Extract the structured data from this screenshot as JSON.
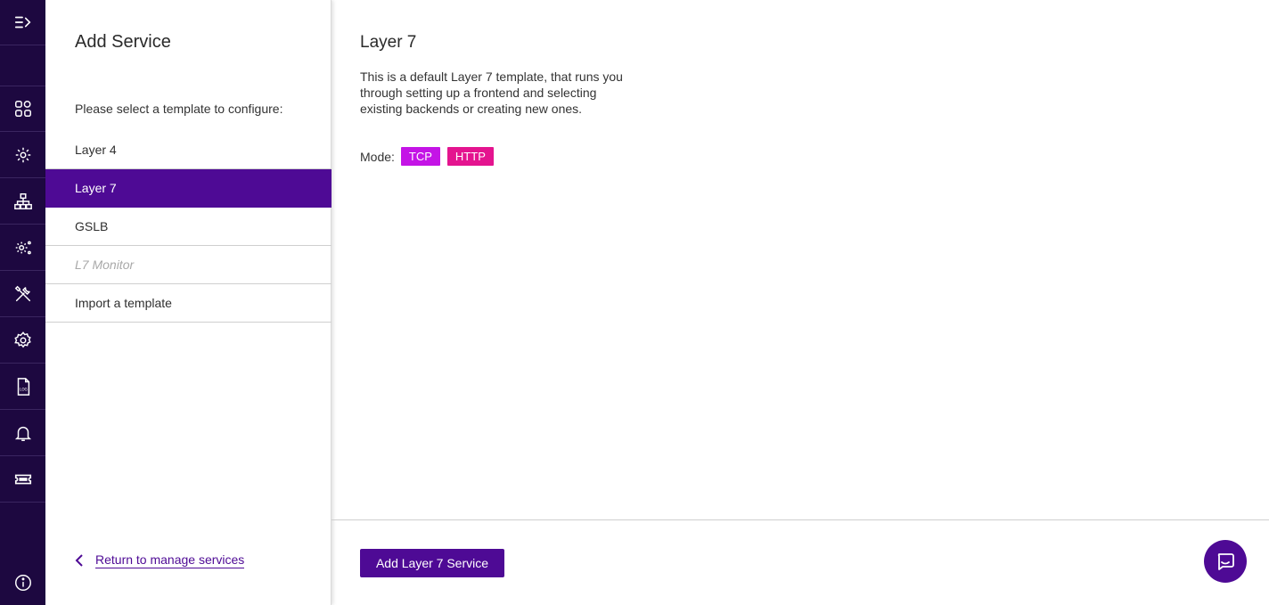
{
  "rail": {
    "items": [
      {
        "icon": "expand-menu-icon"
      },
      {
        "icon": "dashboard-icon"
      },
      {
        "icon": "services-gear-icon"
      },
      {
        "icon": "network-icon"
      },
      {
        "icon": "advanced-settings-icon"
      },
      {
        "icon": "tools-icon"
      },
      {
        "icon": "settings-icon"
      },
      {
        "icon": "log-file-icon"
      },
      {
        "icon": "notification-bell-icon"
      },
      {
        "icon": "license-ticket-icon"
      }
    ],
    "footer_icon": "info-icon"
  },
  "panel": {
    "title": "Add Service",
    "prompt": "Please select a template to configure:",
    "templates": [
      {
        "label": "Layer 4",
        "state": "normal"
      },
      {
        "label": "Layer 7",
        "state": "active"
      },
      {
        "label": "GSLB",
        "state": "normal"
      },
      {
        "label": "L7 Monitor",
        "state": "disabled"
      },
      {
        "label": "Import a template",
        "state": "normal"
      }
    ],
    "return_link": "Return to manage services"
  },
  "detail": {
    "title": "Layer 7",
    "description": "This is a default Layer 7 template, that runs you through setting up a frontend and selecting existing backends or creating new ones.",
    "mode_label": "Mode:",
    "modes": [
      {
        "label": "TCP",
        "color": "#c414e6"
      },
      {
        "label": "HTTP",
        "color": "#e4148f"
      }
    ],
    "add_button": "Add Layer 7 Service"
  },
  "colors": {
    "rail_bg": "#1d0840",
    "accent": "#4e0a95",
    "tcp": "#c414e6",
    "http": "#e4148f"
  }
}
